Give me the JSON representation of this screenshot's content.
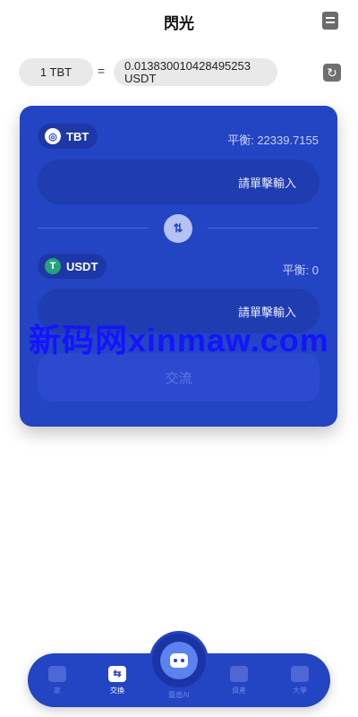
{
  "header": {
    "title": "閃光",
    "icon": "receipt-icon"
  },
  "rate": {
    "from": "1 TBT",
    "equals": "=",
    "to_value": "0.013830010428495253",
    "to_unit": "USDT",
    "refresh_icon": "refresh-icon"
  },
  "from_token": {
    "symbol": "TBT",
    "icon_glyph": "◎",
    "balance": "平衡: 22339.7155",
    "placeholder": "請單擊輸入"
  },
  "swap_icon": "⇅",
  "to_token": {
    "symbol": "USDT",
    "icon_glyph": "T",
    "balance": "平衡: 0",
    "placeholder": "請單擊輸入"
  },
  "exchange_label": "交流",
  "watermark": "新码网xinmaw.com",
  "nav": {
    "items": [
      {
        "label": "家",
        "icon": "home-icon"
      },
      {
        "label": "交換",
        "icon": "swap-icon",
        "glyph": "⇆"
      },
      {
        "label": "資產",
        "icon": "wallet-icon"
      },
      {
        "label": "大學",
        "icon": "chat-icon"
      }
    ],
    "center_label": "籠盾AI"
  },
  "colors": {
    "accent": "#2344c3",
    "usdt": "#26a17b"
  }
}
